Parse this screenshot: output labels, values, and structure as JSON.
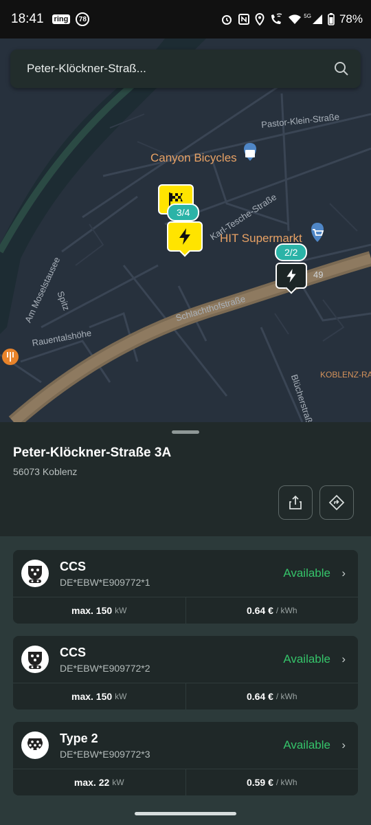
{
  "status_bar": {
    "time": "18:41",
    "left_icons": [
      "ring",
      "78"
    ],
    "right_icons": [
      "alarm-icon",
      "nfc-icon",
      "location-icon",
      "wifi-call-icon",
      "wifi-icon",
      "signal-icon",
      "battery-icon"
    ],
    "network": "5G",
    "battery": "78%"
  },
  "search": {
    "query": "Peter-Klöckner-Straß..."
  },
  "map": {
    "street_labels": [
      "Pastor-Klein-Straße",
      "Karl-Tesche-Straße",
      "Schlachthofstraße",
      "Am Moselstausee",
      "Spitz",
      "Rauentalshöhe",
      "Blücherstraße",
      "KOBLENZ-RA",
      "49"
    ],
    "pois": [
      "Canyon Bicycles",
      "HIT Supermarkt"
    ],
    "markers": [
      {
        "type": "finish",
        "count": "3/4"
      },
      {
        "type": "charge",
        "count": ""
      },
      {
        "type": "charge-dark",
        "count": "2/2"
      }
    ]
  },
  "location": {
    "title": "Peter-Klöckner-Straße 3A",
    "postcode": "56073 Koblenz"
  },
  "connectors": [
    {
      "name": "CCS",
      "id": "DE*EBW*E909772*1",
      "status": "Available",
      "power": "max. 150",
      "power_unit": "kW",
      "price": "0.64 €",
      "price_unit": "/ kWh",
      "plug": "ccs"
    },
    {
      "name": "CCS",
      "id": "DE*EBW*E909772*2",
      "status": "Available",
      "power": "max. 150",
      "power_unit": "kW",
      "price": "0.64 €",
      "price_unit": "/ kWh",
      "plug": "ccs"
    },
    {
      "name": "Type 2",
      "id": "DE*EBW*E909772*3",
      "status": "Available",
      "power": "max. 22",
      "power_unit": "kW",
      "price": "0.59 €",
      "price_unit": "/ kWh",
      "plug": "type2"
    }
  ],
  "colors": {
    "accent_green": "#35c46a",
    "marker_yellow": "#ffe400",
    "badge_teal": "#2bb3a7"
  }
}
